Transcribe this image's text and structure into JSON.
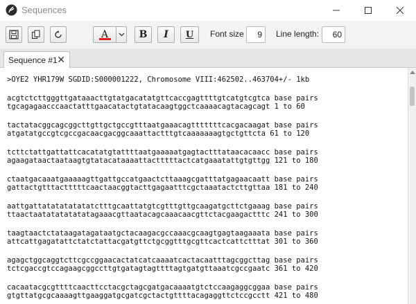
{
  "window": {
    "title": "Sequences"
  },
  "toolbar": {
    "font_size_label": "Font size",
    "font_size_value": "9",
    "line_length_label": "Line length:",
    "line_length_value": "60",
    "bold_label": "B",
    "italic_label": "I",
    "underline_label": "U",
    "font_color_label": "A",
    "font_color": "#e02020"
  },
  "tabs": [
    {
      "label": "Sequence #1",
      "close": "✕"
    }
  ],
  "document": {
    "header": ">OYE2 YHR179W SGDID:S000001222, Chromosome VIII:462502..463704+/- 1kb",
    "blocks": [
      {
        "top": "acgtctcttgggttgataaacttgtatgacatatgttcaccgagttttgtcatgtcgtca base pairs",
        "bottom": "tgcagagaacccaactatttgaacatactgtatacaagtggctcaaaacagtacagcagt 1 to 60"
      },
      {
        "top": "tactatacggcagcggcttgttgctgccgtttaatgaaacagtttttttcacgacaagat base pairs",
        "bottom": "atgatatgccgtcgccgacaacgacggcaaattactttgtcaaaaaaagtgctgttcta 61 to 120"
      },
      {
        "top": "tcttctattgattattcacatatgtattttaatgaaaaatgagtactttataacacaacc base pairs",
        "bottom": "agaagataactaataagtgtatacataaaattactttttactcatgaaatattgtgttgg 121 to 180"
      },
      {
        "top": "ctaatgacaaatgaaaaagttgattgccatgaactcttaaagcgatttatgagaacaatt base pairs",
        "bottom": "gattactgtttactttttcaactaacggtacttgagaatttcgctaaatactcttgttaa 181 to 240"
      },
      {
        "top": "aattgattatatatatatatctttgcaattatgtcgtttgttgcaagatgcttctgaaag base pairs",
        "bottom": "ttaactaatatatatatatagaaacgttaatacagcaaacaacgttctacgaagactttc 241 to 300"
      },
      {
        "top": "taagtaactctataagatagataatgctacaagacgccaaacgcaagtgagtaagaaata base pairs",
        "bottom": "attcattgagatattctatctattacgatgttctgcggtttgcgttcactcattctttat 301 to 360"
      },
      {
        "top": "agagctggcaggtcttcgccggaacactatcatcaaaatcactacaatttagcggcttag base pairs",
        "bottom": "tctcgaccgtccagaagcggccttgtgatagtagttttagtgatgttaaatcgccgaatc 361 to 420"
      },
      {
        "top": "cacaatacgcgttttcaacttcctacgctagcgatgacaaaatgtctccaagaggcggaa base pairs",
        "bottom": "gtgttatgcgcaaaagttgaaggatgcgatcgctactgttttacagaggttctccgcctt 421 to 480"
      }
    ]
  }
}
